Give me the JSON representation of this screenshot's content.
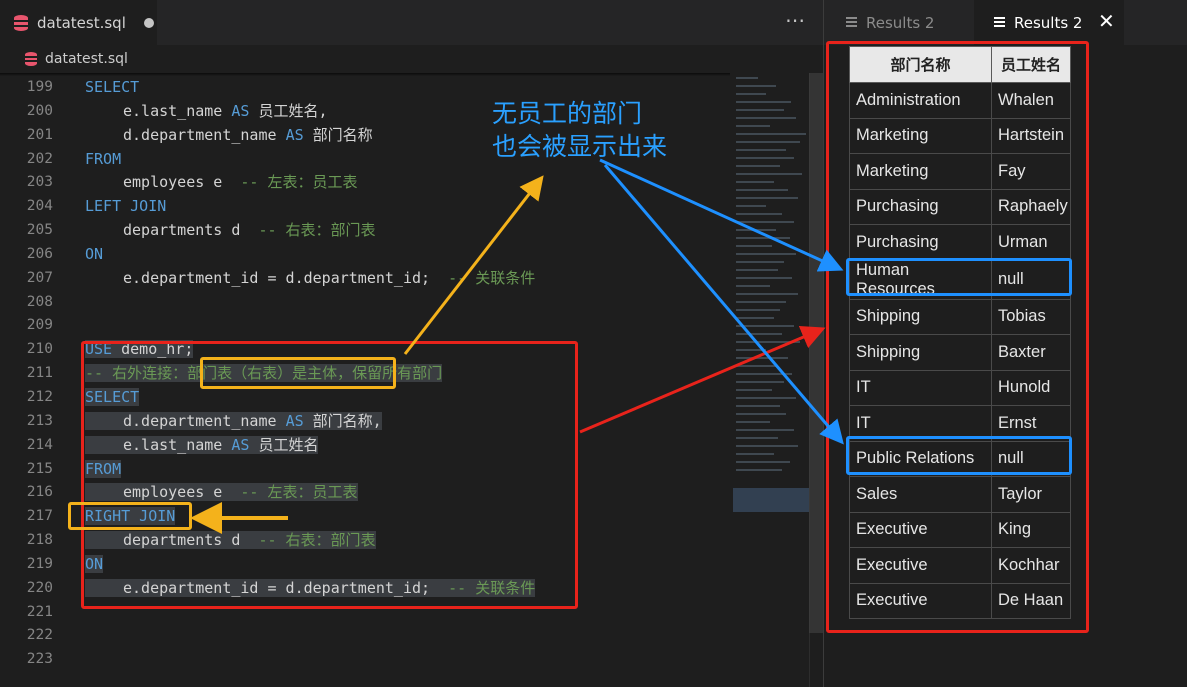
{
  "editor": {
    "tab_title": "datatest.sql",
    "more_icon": "⋯",
    "breadcrumb_file": "datatest.sql",
    "line_numbers": [
      "199",
      "200",
      "201",
      "202",
      "203",
      "204",
      "205",
      "206",
      "207",
      "208",
      "209",
      "210",
      "211",
      "212",
      "213",
      "214",
      "215",
      "216",
      "217",
      "218",
      "219",
      "220",
      "221",
      "222",
      "223"
    ],
    "code": {
      "l199_kw": "SELECT",
      "l200_a": "e.last_name ",
      "l200_kw": "AS",
      "l200_b": " 员工姓名,",
      "l201_a": "d.department_name ",
      "l201_kw": "AS",
      "l201_b": " 部门名称",
      "l202_kw": "FROM",
      "l203_a": "employees e  ",
      "l203_cm": "-- 左表：员工表",
      "l204_kw": "LEFT JOIN",
      "l205_a": "departments d  ",
      "l205_cm": "-- 右表：部门表",
      "l206_kw": "ON",
      "l207_a": "e.department_id = d.department_id;  ",
      "l207_cm": "-- 关联条件",
      "l210_kw": "USE",
      "l210_a": " demo_hr;",
      "l211_cm": "-- 右外连接：部门表（右表）是主体，保留所有部门",
      "l212_kw": "SELECT",
      "l213_a": "d.department_name ",
      "l213_kw": "AS",
      "l213_b": " 部门名称,",
      "l214_a": "e.last_name ",
      "l214_kw": "AS",
      "l214_b": " 员工姓名",
      "l215_kw": "FROM",
      "l216_a": "employees e  ",
      "l216_cm": "-- 左表：员工表",
      "l217_kw": "RIGHT JOIN",
      "l218_a": "departments d  ",
      "l218_cm": "-- 右表：部门表",
      "l219_kw": "ON",
      "l220_a": "e.department_id = d.department_id;  ",
      "l220_cm": "-- 关联条件"
    }
  },
  "results": {
    "tab1_label": "Results 2",
    "tab2_label": "Results 2",
    "close_icon": "✕",
    "columns": [
      "部门名称",
      "员工姓名"
    ],
    "rows": [
      [
        "Administration",
        "Whalen"
      ],
      [
        "Marketing",
        "Hartstein"
      ],
      [
        "Marketing",
        "Fay"
      ],
      [
        "Purchasing",
        "Raphaely"
      ],
      [
        "Purchasing",
        "Urman"
      ],
      [
        "Human Resources",
        "null"
      ],
      [
        "Shipping",
        "Tobias"
      ],
      [
        "Shipping",
        "Baxter"
      ],
      [
        "IT",
        "Hunold"
      ],
      [
        "IT",
        "Ernst"
      ],
      [
        "Public Relations",
        "null"
      ],
      [
        "Sales",
        "Taylor"
      ],
      [
        "Executive",
        "King"
      ],
      [
        "Executive",
        "Kochhar"
      ],
      [
        "Executive",
        "De Haan"
      ]
    ]
  },
  "annotation": {
    "note_line1": "无员工的部门",
    "note_line2": "也会被显示出来",
    "colors": {
      "red": "#e8231b",
      "orange": "#f4b21b",
      "blue": "#1e90ff"
    }
  }
}
